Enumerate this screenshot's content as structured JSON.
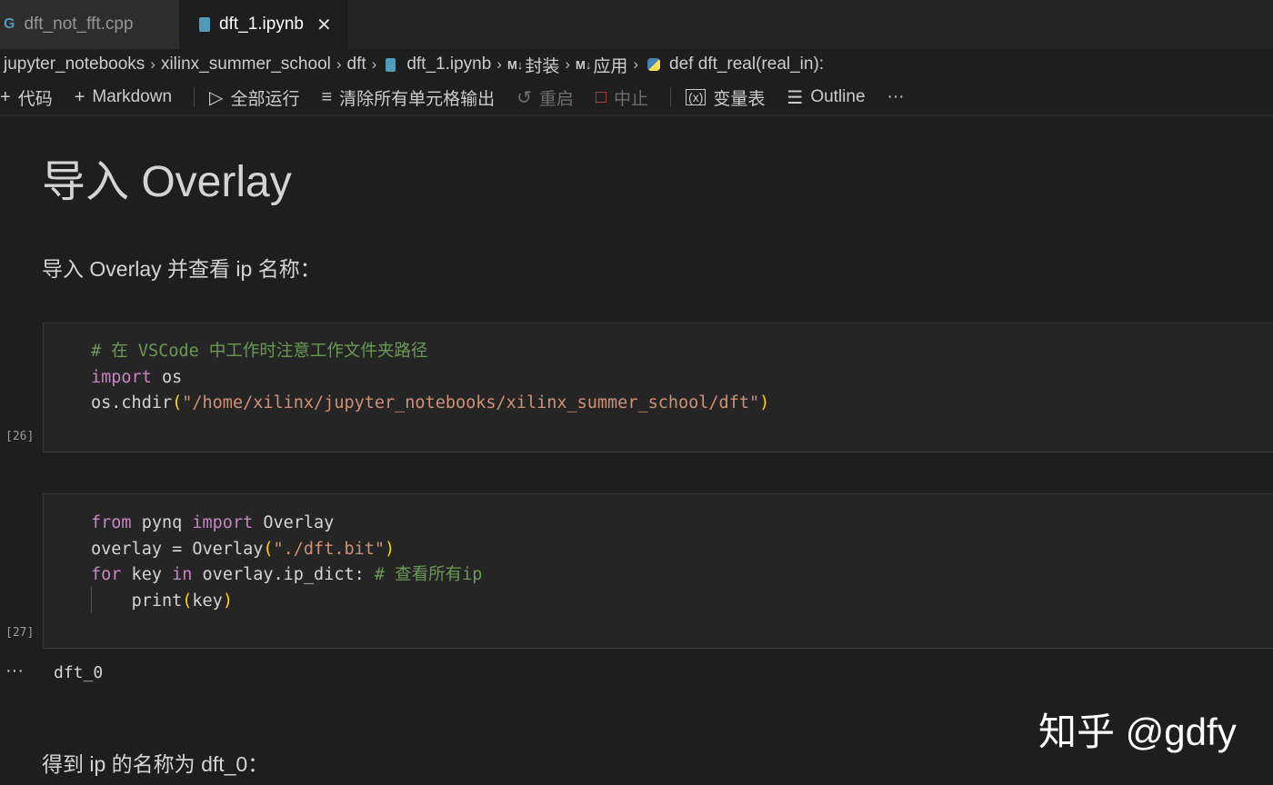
{
  "tabs": [
    {
      "label": "dft_not_fft.cpp",
      "icon": "cpp-icon",
      "active": false
    },
    {
      "label": "dft_1.ipynb",
      "icon": "notebook-icon",
      "active": true
    }
  ],
  "breadcrumb": {
    "items": [
      "jupyter_notebooks",
      "xilinx_summer_school",
      "dft",
      "dft_1.ipynb",
      "封装",
      "应用",
      "def dft_real(real_in):"
    ],
    "md_badge": "M↓"
  },
  "toolbar": {
    "code": "代码",
    "markdown": "Markdown",
    "run_all": "全部运行",
    "clear_outputs": "清除所有单元格输出",
    "restart": "重启",
    "interrupt": "中止",
    "variables": "变量表",
    "outline": "Outline",
    "more": "···"
  },
  "notebook": {
    "heading": "导入 Overlay",
    "intro": "导入 Overlay 并查看 ip 名称：",
    "cell1": {
      "exec_count": "[26]",
      "comment": "# 在 VSCode 中工作时注意工作文件夹路径",
      "kw_import": "import",
      "mod": " os",
      "call": "os.chdir",
      "str": "\"/home/xilinx/jupyter_notebooks/xilinx_summer_school/dft\""
    },
    "cell2": {
      "exec_count": "[27]",
      "kw_from": "from",
      "mod": " pynq ",
      "kw_import": "import",
      "cls": " Overlay",
      "assign": "overlay = Overlay",
      "str": "\"./dft.bit\"",
      "kw_for": "for",
      "var": " key ",
      "kw_in": "in",
      "iter": " overlay.ip_dict: ",
      "comment": "# 查看所有ip",
      "print_call": "print",
      "print_arg": "key"
    },
    "output_marker": "···",
    "output": "dft_0",
    "result": "得到 ip 的名称为 dft_0："
  },
  "watermark": "知乎 @gdfy"
}
